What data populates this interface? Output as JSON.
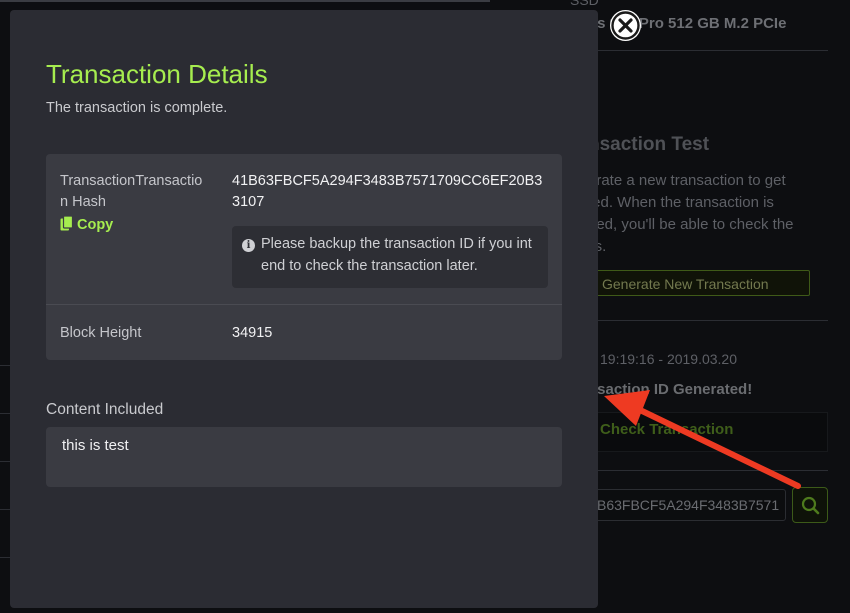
{
  "modal": {
    "title": "Transaction Details",
    "subtitle": "The transaction is complete.",
    "hash_label": "TransactionTransaction Hash",
    "copy_label": "Copy",
    "hash_value": "41B63FBCF5A294F3483B7571709CC6EF20B33107",
    "note": "Please backup the transaction ID if you intend to check the transaction later.",
    "block_height_label": "Block Height",
    "block_height_value": "34915",
    "content_label": "Content Included",
    "content_value": "this is test",
    "accent_color": "#a6ed4f"
  },
  "background": {
    "ssd_label": "SSD",
    "ssd_value": "ns 960 Pro 512 GB M.2 PCIe",
    "test_title": "nsaction Test",
    "test_desc_1": "erate a new transaction to get",
    "test_desc_2": "ted. When the transaction is",
    "test_desc_3": "hed, you'll be able to check the",
    "test_desc_4": "ils.",
    "generate_button": "Generate New Transaction",
    "timestamp": "19:19:16 - 2019.03.20",
    "generated_text": "nsaction ID Generated!",
    "check_link": "Check Transaction",
    "search_value": "B63FBCF5A294F3483B7571"
  },
  "icons": {
    "close": "close-circle-icon",
    "copy": "copy-icon",
    "info": "info-icon",
    "search": "search-icon",
    "arrow": "red-arrow-annotation"
  }
}
